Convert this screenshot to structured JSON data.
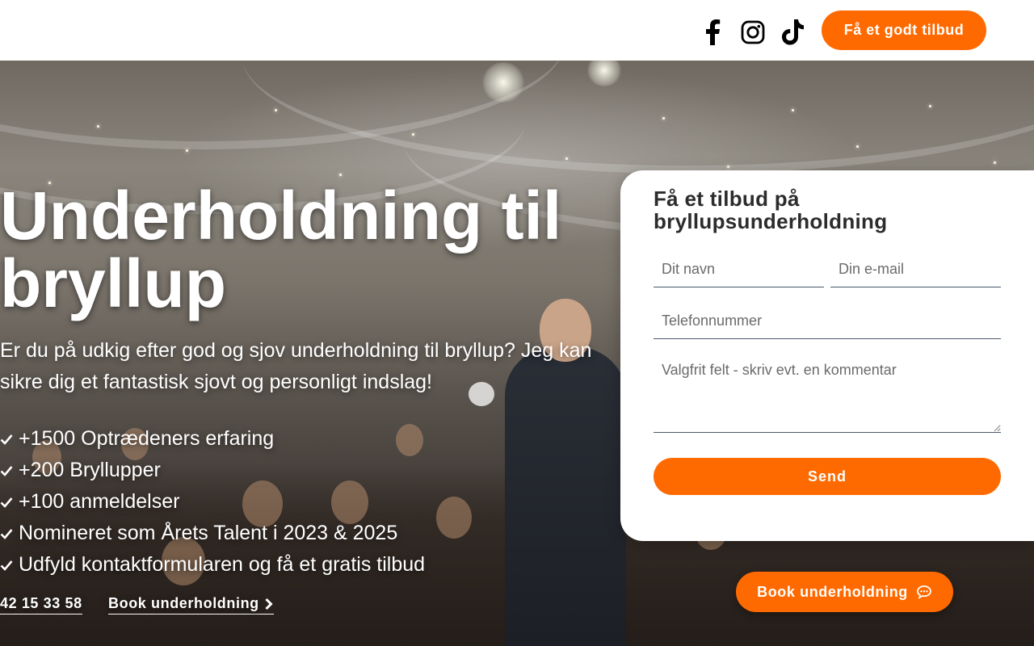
{
  "header": {
    "social": [
      {
        "name": "facebook-icon"
      },
      {
        "name": "instagram-icon"
      },
      {
        "name": "tiktok-icon"
      }
    ],
    "cta_label": "Få et godt tilbud"
  },
  "hero": {
    "title": "Underholdning til bryllup",
    "subtitle": "Er du på udkig efter god og sjov underholdning til bryllup? Jeg kan sikre dig et fantastisk sjovt og personligt indslag!",
    "features": [
      "+1500 Optrædeners erfaring",
      "+200 Bryllupper",
      "+100 anmeldelser",
      "Nomineret som Årets Talent i 2023 & 2025",
      "Udfyld kontaktformularen og få et gratis tilbud"
    ],
    "feature_icon": "check-icon",
    "phone": "42 15 33 58",
    "book_link": "Book underholdning",
    "book_link_icon": "chevron-right-icon"
  },
  "form": {
    "title": "Få et tilbud på bryllupsunderholdning",
    "name_placeholder": "Dit navn",
    "email_placeholder": "Din e-mail",
    "phone_placeholder": "Telefonnummer",
    "comment_placeholder": "Valgfrit felt - skriv evt. en kommentar",
    "submit_label": "Send"
  },
  "floating_button": {
    "label": "Book underholdning",
    "icon": "chat-bubble-icon"
  },
  "colors": {
    "accent": "#ff6a00",
    "header_bg": "#ffffff",
    "card_bg": "#ffffff"
  }
}
